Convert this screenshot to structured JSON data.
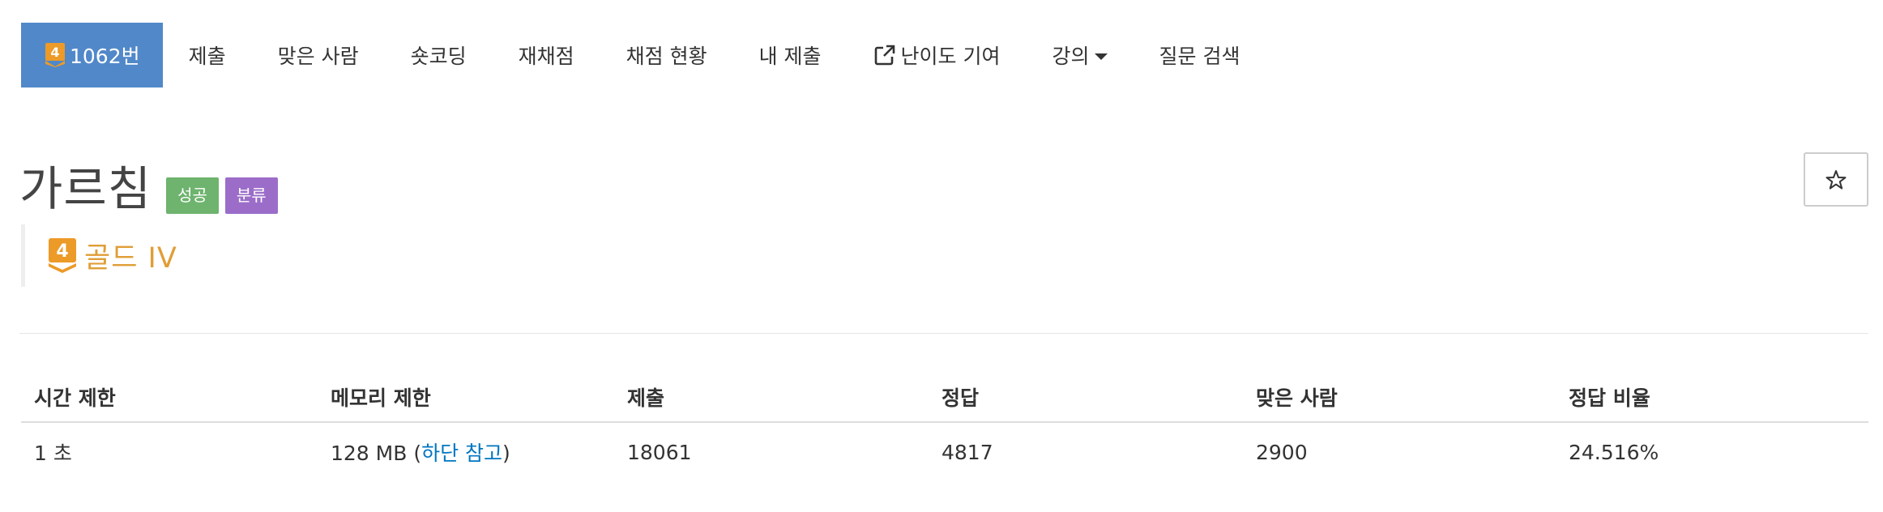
{
  "nav": {
    "problem_tab": {
      "tier_number": "4",
      "number_label": "1062번"
    },
    "items": [
      {
        "label": "제출"
      },
      {
        "label": "맞은 사람"
      },
      {
        "label": "숏코딩"
      },
      {
        "label": "재채점"
      },
      {
        "label": "채점 현황"
      },
      {
        "label": "내 제출"
      },
      {
        "label": "난이도 기여"
      },
      {
        "label": "강의"
      },
      {
        "label": "질문 검색"
      }
    ],
    "colors": {
      "active_bg": "#5188c9",
      "tier_gold": "#e09e37"
    }
  },
  "problem": {
    "title": "가르침",
    "badges": [
      {
        "label": "성공",
        "color": "#6eb36e"
      },
      {
        "label": "분류",
        "color": "#9b6dc9"
      }
    ],
    "tier": {
      "number": "4",
      "label": "골드 IV"
    },
    "star_icon": "star-outline-icon"
  },
  "info_table": {
    "headers": [
      "시간 제한",
      "메모리 제한",
      "제출",
      "정답",
      "맞은 사람",
      "정답 비율"
    ],
    "row": {
      "time_limit": "1 초",
      "memory_value": "128 MB (",
      "memory_link": "하단 참고",
      "memory_close": ")",
      "submissions": "18061",
      "accepted": "4817",
      "solvers": "2900",
      "ratio": "24.516%"
    }
  }
}
